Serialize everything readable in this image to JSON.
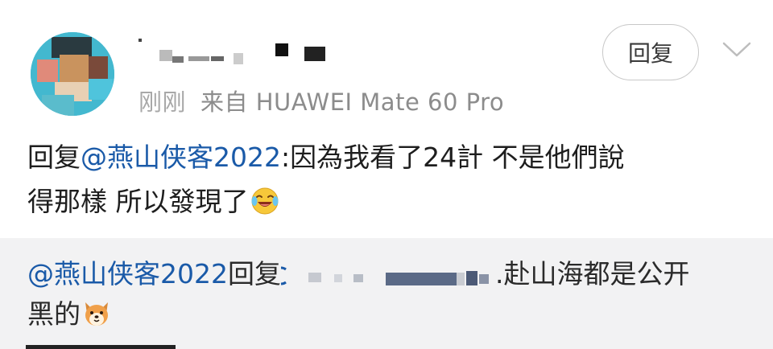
{
  "post": {
    "meta": {
      "time": "刚刚",
      "source": "来自 HUAWEI Mate 60 Pro"
    },
    "reply_label": "回复"
  },
  "comment": {
    "prefix": "回复",
    "mention": "@燕山侠客2022",
    "text_line1": ":因為我看了24計 不是他們說",
    "text_line2": "得那樣 所以發現了"
  },
  "quote": {
    "mention": "@燕山侠客2022",
    "reply_word": "回复",
    "tail": ".赴山海都是公开",
    "line2": "黑的"
  },
  "icons": {
    "expand": "chevron-down-icon",
    "laugh_emoji": "laughing-crying-emoji",
    "dog_emoji": "dog-face-emoji"
  },
  "colors": {
    "mention": "#1a5aa8",
    "meta": "#8c8c8c",
    "quote_bg": "#f2f2f3"
  }
}
